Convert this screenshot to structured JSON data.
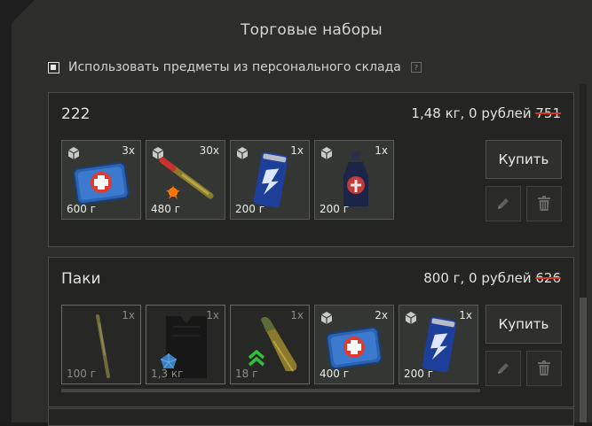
{
  "window": {
    "title": "Торговые наборы"
  },
  "options": {
    "use_storage_label": "Использовать предметы из персонального склада",
    "help_label": "?"
  },
  "sets": [
    {
      "name": "222",
      "price_text": "1,48 кг, 0 рублей",
      "old_price": "751",
      "buy_label": "Купить",
      "items": [
        {
          "name": "medkit",
          "qty": "3x",
          "weight": "600 г",
          "from_storage": true
        },
        {
          "name": "glowstick",
          "qty": "30x",
          "weight": "480 г",
          "from_storage": true
        },
        {
          "name": "energy-drink",
          "qty": "1x",
          "weight": "200 г",
          "from_storage": true
        },
        {
          "name": "bottle-drink",
          "qty": "1x",
          "weight": "200 г",
          "from_storage": true
        }
      ]
    },
    {
      "name": "Паки",
      "price_text": "800 г, 0 рублей",
      "old_price": "626",
      "buy_label": "Купить",
      "items": [
        {
          "name": "stick",
          "qty": "1x",
          "weight": "100 г",
          "from_storage": false
        },
        {
          "name": "vest",
          "qty": "1x",
          "weight": "1,3 кг",
          "from_storage": false
        },
        {
          "name": "ammo-round",
          "qty": "1x",
          "weight": "18 г",
          "from_storage": false
        },
        {
          "name": "medkit",
          "qty": "2x",
          "weight": "400 г",
          "from_storage": true
        },
        {
          "name": "energy-drink",
          "qty": "1x",
          "weight": "200 г",
          "from_storage": true
        }
      ]
    }
  ],
  "icons": {
    "storage": "cube-icon",
    "edit": "pencil-icon",
    "delete": "trash-icon",
    "rank": "chevron-up-icon",
    "rarity": "pentagon-icon"
  },
  "colors": {
    "strike": "#e0321c",
    "rank_green": "#2fbf3a",
    "rarity_blue": "#3b7fc4"
  }
}
